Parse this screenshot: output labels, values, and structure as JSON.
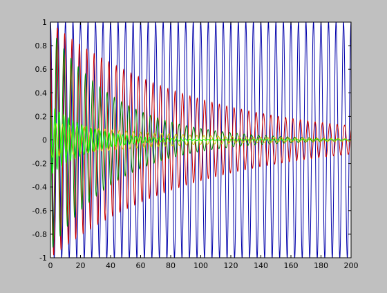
{
  "figure": {
    "background_color": "#c0c0c0",
    "axes_background_color": "#ffffff"
  },
  "chart_data": {
    "type": "line",
    "xlim": [
      0,
      200
    ],
    "ylim": [
      -1,
      1
    ],
    "xticks": [
      0,
      20,
      40,
      60,
      80,
      100,
      120,
      140,
      160,
      180,
      200
    ],
    "xtick_labels": [
      "0",
      "20",
      "40",
      "60",
      "80",
      "100",
      "120",
      "140",
      "160",
      "180",
      "200"
    ],
    "yticks": [
      -1,
      -0.8,
      -0.6,
      -0.4,
      -0.2,
      0,
      0.2,
      0.4,
      0.6,
      0.8,
      1
    ],
    "ytick_labels": [
      "-1",
      "-0.8",
      "-0.6",
      "-0.4",
      "-0.2",
      "0",
      "0.2",
      "0.4",
      "0.6",
      "0.8",
      "1"
    ],
    "grid": false,
    "series": [
      {
        "color": "#0000aa",
        "description": "undamped oscillation, amplitude 1",
        "amplitude_start": 1.0,
        "amplitude_end": 1.0,
        "period": 5.0,
        "phase": 0.0
      },
      {
        "color": "#cc0000",
        "description": "slowly damped oscillation",
        "amplitude_start": 1.0,
        "amplitude_end": 0.12,
        "period": 4.9,
        "phase": 0.4
      },
      {
        "color": "#008800",
        "description": "damped oscillation",
        "amplitude_start": 0.95,
        "amplitude_end": 0.01,
        "period": 4.8,
        "phase": 0.9
      },
      {
        "color": "#cccc00",
        "description": "damped oscillation near zero",
        "amplitude_start": 0.15,
        "amplitude_end": 0.01,
        "period": 4.7,
        "phase": 1.6
      },
      {
        "color": "#00ff00",
        "description": "fast damped oscillation",
        "amplitude_start": 0.3,
        "amplitude_end": 0.0,
        "period": 3.0,
        "phase": 0.2
      }
    ]
  }
}
